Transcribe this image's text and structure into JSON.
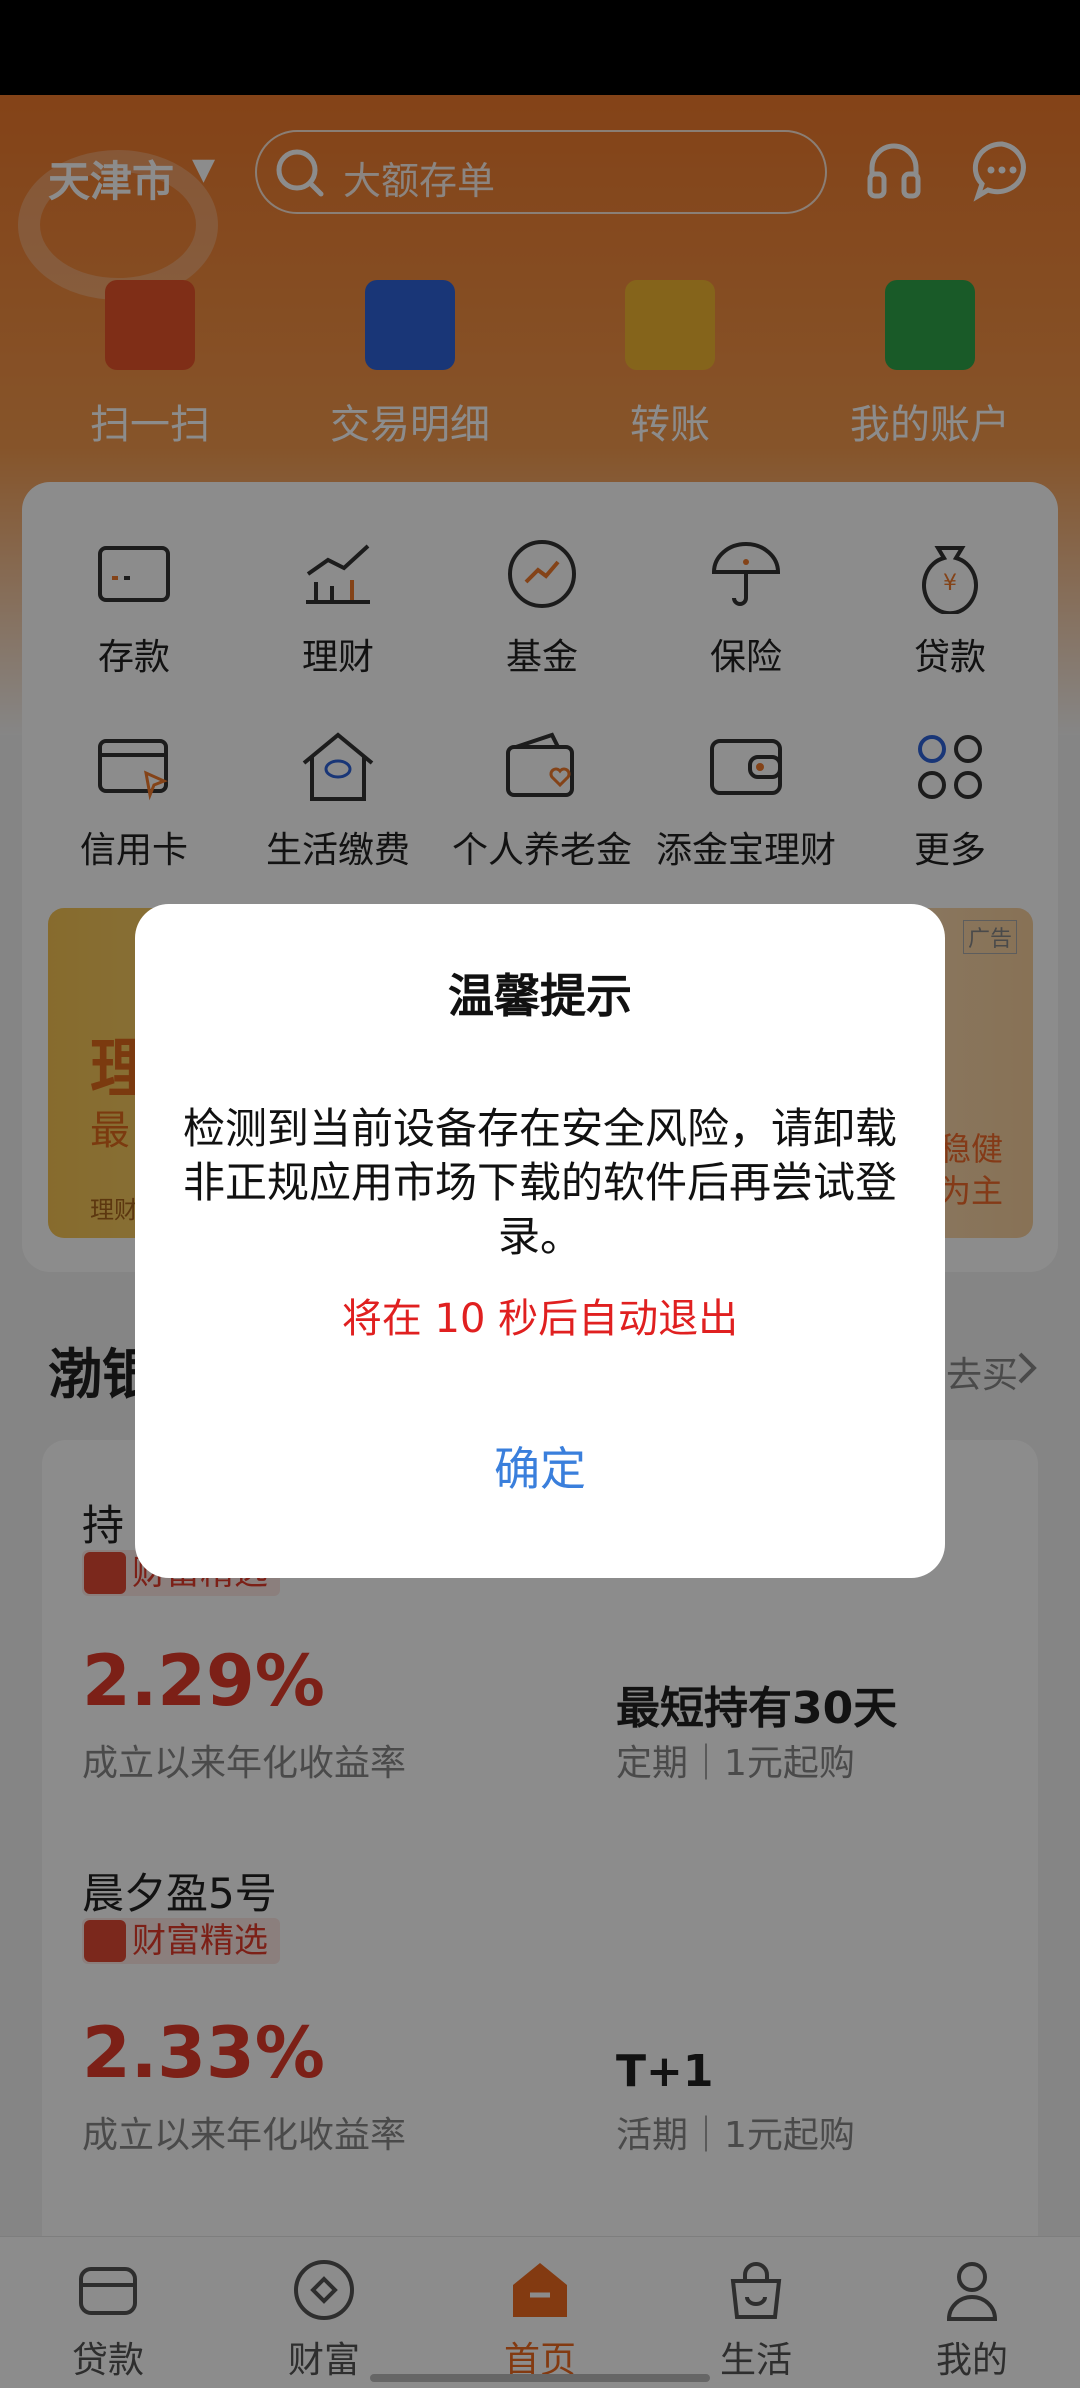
{
  "header": {
    "city": "天津市",
    "search_placeholder": "大额存单"
  },
  "quick_actions": [
    {
      "label": "扫一扫",
      "color": "#e8542a"
    },
    {
      "label": "交易明细",
      "color": "#2f63d9"
    },
    {
      "label": "转账",
      "color": "#f2b632"
    },
    {
      "label": "我的账户",
      "color": "#2fa44a"
    }
  ],
  "services": [
    {
      "label": "存款",
      "icon": "card-icon"
    },
    {
      "label": "理财",
      "icon": "chart-icon"
    },
    {
      "label": "基金",
      "icon": "fund-icon"
    },
    {
      "label": "保险",
      "icon": "umbrella-icon"
    },
    {
      "label": "贷款",
      "icon": "money-bag-icon"
    },
    {
      "label": "信用卡",
      "icon": "credit-card-icon"
    },
    {
      "label": "生活缴费",
      "icon": "house-icon"
    },
    {
      "label": "个人养老金",
      "icon": "wallet-heart-icon"
    },
    {
      "label": "添金宝理财",
      "icon": "wallet-icon"
    },
    {
      "label": "更多",
      "icon": "more-icon"
    }
  ],
  "banner": {
    "title": "理",
    "subtitle": "最",
    "footnote": "理财",
    "ad_label": "广告",
    "right_text_1": "对稳健",
    "right_text_2": "资为主"
  },
  "section": {
    "title": "渤银",
    "more_label": "去买"
  },
  "products": [
    {
      "name": "持",
      "tag": "财富精选",
      "rate": "2.29%",
      "rate_label": "成立以来年化收益率",
      "term": "最短持有30天",
      "term_detail": "定期｜1元起购"
    },
    {
      "name": "晨夕盈5号",
      "tag": "财富精选",
      "rate": "2.33%",
      "rate_label": "成立以来年化收益率",
      "term": "T+1",
      "term_detail": "活期｜1元起购"
    }
  ],
  "tabs": [
    {
      "label": "贷款",
      "active": false
    },
    {
      "label": "财富",
      "active": false
    },
    {
      "label": "首页",
      "active": true
    },
    {
      "label": "生活",
      "active": false
    },
    {
      "label": "我的",
      "active": false
    }
  ],
  "dialog": {
    "title": "温馨提示",
    "message": "检测到当前设备存在安全风险，请卸载非正规应用市场下载的软件后再尝试登录。",
    "countdown": "将在 10 秒后自动退出",
    "confirm": "确定"
  },
  "colors": {
    "brand": "#ef6a1f",
    "rate": "#e23b2a",
    "confirm": "#3a7fdc",
    "countdown": "#e02020"
  }
}
